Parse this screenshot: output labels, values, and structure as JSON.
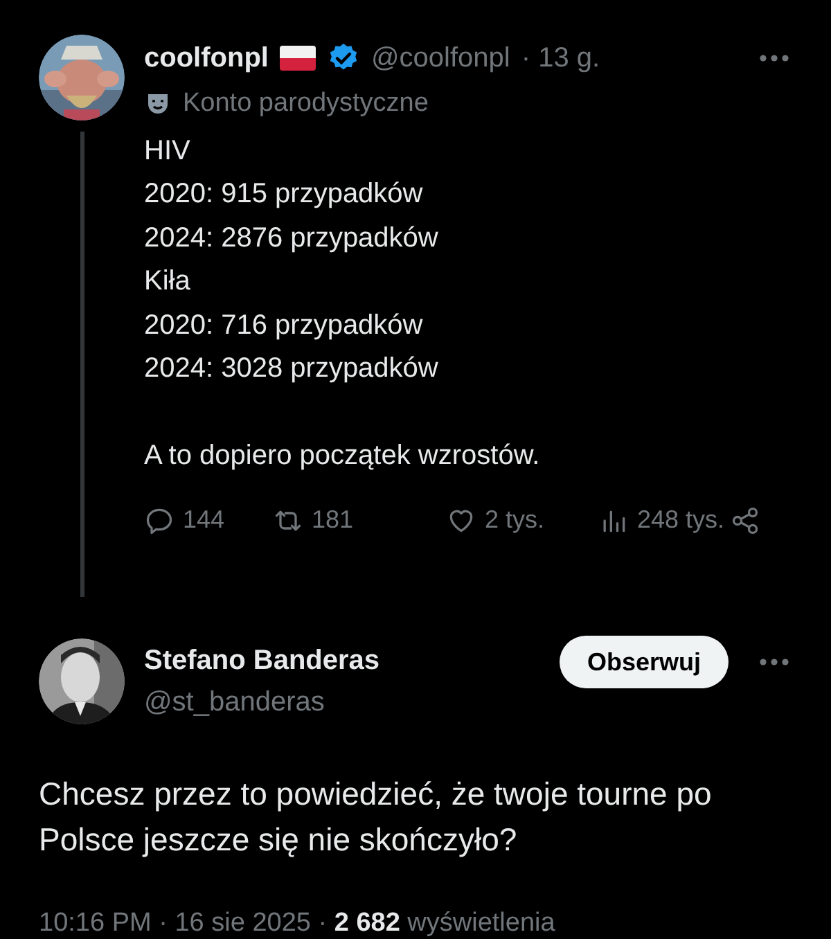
{
  "post": {
    "author": {
      "name": "coolfonpl",
      "handle": "@coolfonpl",
      "time": "· 13 g.",
      "verified": true
    },
    "label": "Konto parodystyczne",
    "paragraphs": [
      [
        "HIV",
        "2020: 915 przypadków",
        "2024: 2876 przypadków",
        "Kiła",
        "2020: 716 przypadków",
        "2024: 3028 przypadków"
      ],
      [
        "A to dopiero początek wzrostów."
      ]
    ],
    "stats": [
      {
        "kind": "reply",
        "count": "144"
      },
      {
        "kind": "repost",
        "count": "181"
      },
      {
        "kind": "like",
        "count": "2 tys."
      },
      {
        "kind": "views",
        "count": "248 tys."
      }
    ]
  },
  "reply": {
    "author": {
      "name": "Stefano Banderas",
      "handle": "@st_banderas"
    },
    "follow_button": "Obserwuj",
    "text": "Chcesz przez to powiedzieć, że twoje tourne po Polsce jeszcze się nie skończyło?",
    "meta": "10:16 PM · 16 sie 2025 · **2 682** wyświetlenia"
  }
}
